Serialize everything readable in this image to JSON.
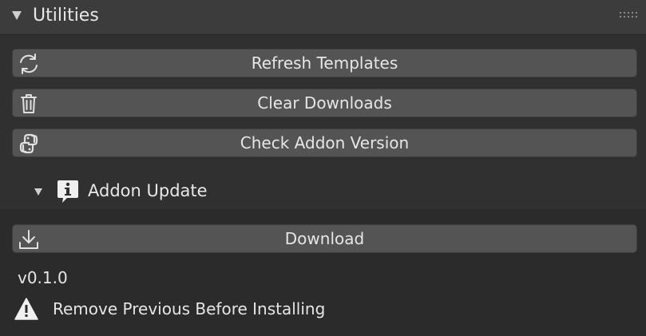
{
  "panel": {
    "title": "Utilities",
    "buttons": {
      "refresh": "Refresh Templates",
      "clear": "Clear Downloads",
      "check": "Check Addon Version"
    }
  },
  "addon_update": {
    "title": "Addon Update",
    "download_label": "Download",
    "version": "v0.1.0",
    "warning": "Remove Previous Before Installing"
  },
  "icons": {
    "collapse_utilities": "triangle-down-icon",
    "drag_handle": "grip-dots-icon",
    "refresh": "refresh-icon",
    "clear": "trash-icon",
    "check": "python-icon",
    "collapse_addon_update": "triangle-down-icon",
    "info": "info-icon",
    "download": "download-icon",
    "warning": "warning-icon"
  },
  "colors": {
    "background": "#2b2b2b",
    "header": "#3c3c3c",
    "subpanel": "#303030",
    "button": "#545454",
    "text": "#e6e6e6"
  }
}
